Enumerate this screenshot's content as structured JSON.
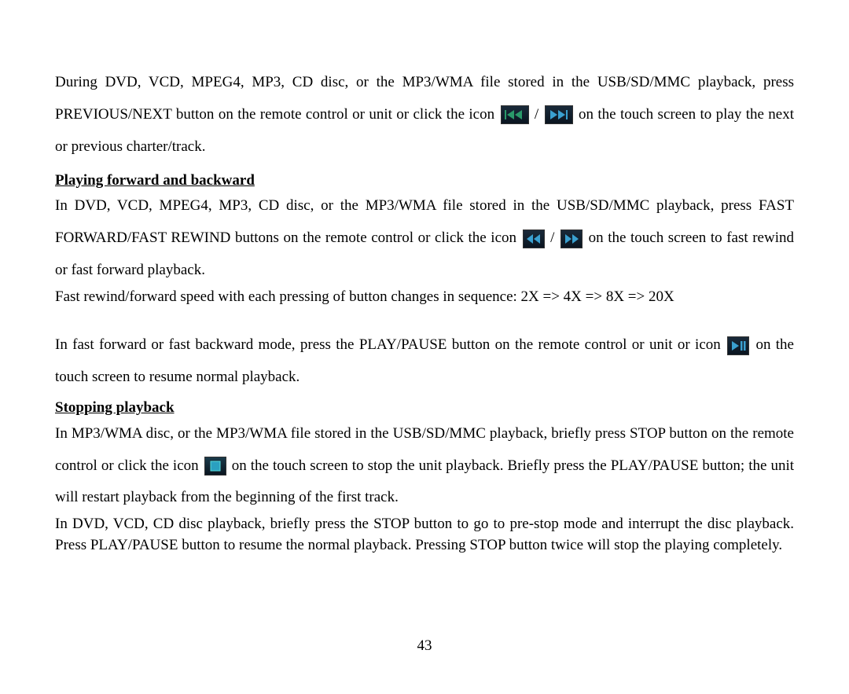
{
  "para1_a": "During DVD, VCD, MPEG4, MP3, CD disc, or the MP3/WMA file stored in the USB/SD/MMC playback, press PREVIOUS/NEXT button on the remote control or unit or click the icon ",
  "slash": " / ",
  "para1_b": " on the touch screen to play the next or previous charter/track.",
  "heading1": "Playing forward and backward",
  "para2_a": "In DVD, VCD, MPEG4, MP3, CD disc, or the MP3/WMA file stored in the USB/SD/MMC playback, press FAST FORWARD/FAST REWIND buttons on the remote control or click the icon ",
  "para2_b": " on the touch screen to fast rewind or fast forward playback.",
  "para3": "Fast rewind/forward speed with each pressing of button changes in sequence: 2X => 4X => 8X => 20X",
  "para4_a": "In fast forward or fast backward mode, press the PLAY/PAUSE button on the remote control or unit or icon ",
  "para4_b": " on the touch screen to resume normal playback.",
  "heading2": "Stopping playback",
  "para5_a": "In MP3/WMA disc, or the MP3/WMA file stored in the USB/SD/MMC playback, briefly press STOP button on the remote control or click the icon ",
  "para5_b": " on the touch screen to stop the unit playback. Briefly press the PLAY/PAUSE button; the unit will restart playback from the beginning of the first track.",
  "para6": "In DVD, VCD, CD disc playback, briefly press the STOP button to go to pre-stop mode and interrupt the disc playback. Press PLAY/PAUSE button to resume the normal playback. Pressing STOP button twice will stop the playing completely.",
  "page_number": "43",
  "icons": {
    "prev": "previous-track-icon",
    "next": "next-track-icon",
    "rewind": "fast-rewind-icon",
    "forward": "fast-forward-icon",
    "playpause": "play-pause-icon",
    "stop": "stop-icon"
  }
}
